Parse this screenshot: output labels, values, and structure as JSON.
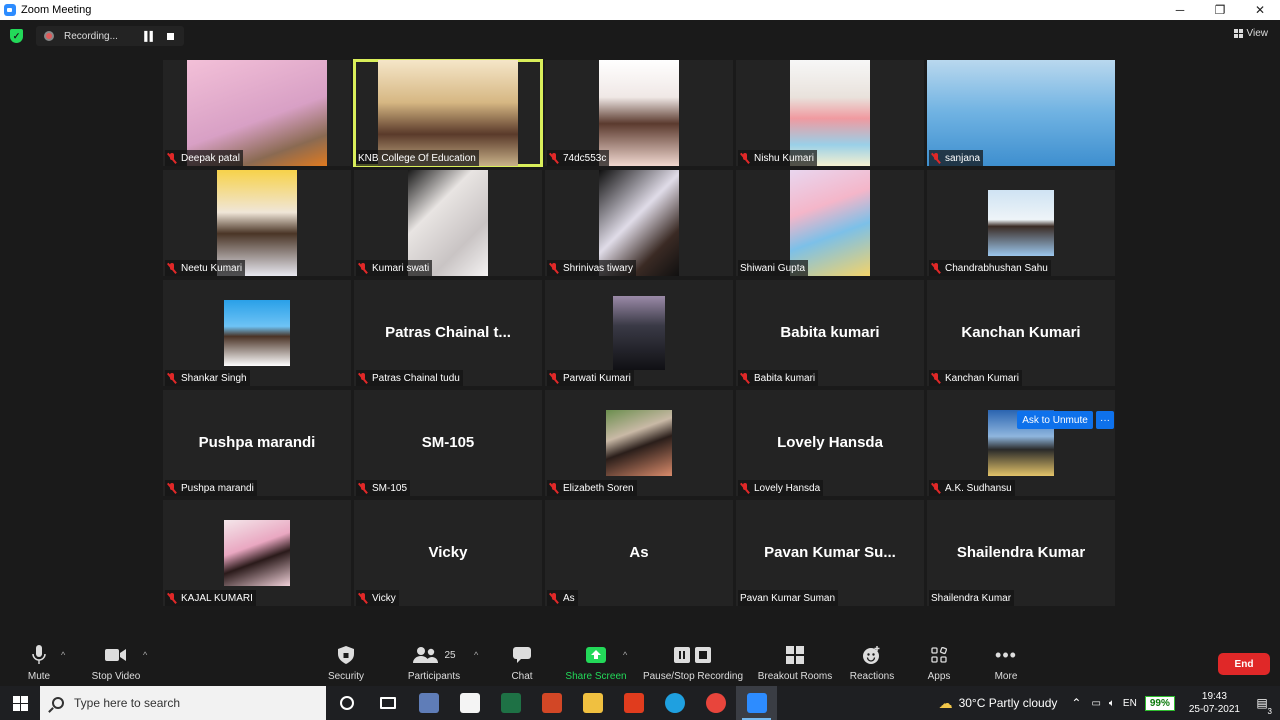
{
  "window": {
    "title": "Zoom Meeting",
    "minimize": "─",
    "restore": "❐",
    "close": "✕"
  },
  "topbar": {
    "recording_label": "Recording...",
    "view_label": "View"
  },
  "tiles": [
    {
      "name": "Deepak patal",
      "muted": true,
      "active": false,
      "video": true,
      "video_width": 140,
      "video_color": "linear-gradient(160deg,#f3c0d8 0%,#d8a0c5 55%,#8a6a52 80%,#e07a20 100%)"
    },
    {
      "name": "KNB College Of Education",
      "muted": false,
      "active": true,
      "video": true,
      "video_width": 140,
      "video_color": "linear-gradient(180deg,#f5e6c8 0%,#d6b783 40%,#5a3a2a 70%,#c9b28a 100%)"
    },
    {
      "name": "74dc553c",
      "muted": true,
      "active": false,
      "video": true,
      "video_width": 80,
      "video_color": "linear-gradient(180deg,#ffffff 0%,#f0e8e6 35%,#5b3a2e 60%,#f1d8d0 100%)"
    },
    {
      "name": "Nishu Kumari",
      "muted": true,
      "active": false,
      "video": true,
      "video_width": 80,
      "video_color": "linear-gradient(180deg,#f7f7f7 0%,#e9e2dc 35%,#f09aa0 55%,#9ad0e8 80%,#f5f0d0 100%)"
    },
    {
      "name": "sanjana",
      "muted": true,
      "active": false,
      "video": true,
      "video_width": 188,
      "video_color": "linear-gradient(180deg,#b9d8ee 0%,#6fb2e2 50%,#3e8fcf 100%)"
    },
    {
      "name": "Neetu Kumari",
      "muted": true,
      "active": false,
      "video": true,
      "video_width": 80,
      "video_color": "linear-gradient(180deg,#f7d24a 0%,#f0e6d8 40%,#4a3526 60%,#e8e8f0 100%)"
    },
    {
      "name": "Kumari swati",
      "muted": true,
      "active": false,
      "video": true,
      "video_width": 80,
      "video_color": "linear-gradient(135deg,#1a1a1a 0%,#e8e4e2 35%,#c9c4c4 70%,#f4f2f2 100%)"
    },
    {
      "name": "Shrinivas tiwary",
      "muted": true,
      "active": false,
      "video": true,
      "video_width": 80,
      "video_color": "linear-gradient(135deg,#101010 0%,#e0dce8 45%,#3a2a24 75%,#101010 100%)"
    },
    {
      "name": "Shiwani Gupta",
      "muted": false,
      "active": false,
      "video": true,
      "video_width": 80,
      "video_color": "linear-gradient(160deg,#e9d6ef 0%,#f4b6c9 35%,#7cc0e8 60%,#f3d36a 100%)"
    },
    {
      "name": "Chandrabhushan Sahu",
      "muted": true,
      "active": false,
      "video": true,
      "video_width": 66,
      "video_color": "linear-gradient(180deg,#cfe3f3 0%,#eef4f8 45%,#3b2c25 55%,#9cc7ee 100%)",
      "video_inset": 20
    },
    {
      "name": "Shankar Singh",
      "muted": true,
      "active": false,
      "video": true,
      "video_width": 66,
      "video_color": "linear-gradient(180deg,#2aa0e8 0%,#6ec3f5 40%,#4a3326 55%,#ffffff 100%)",
      "video_inset": 20
    },
    {
      "name": "Patras Chainal tudu",
      "big_name": "Patras Chainal t...",
      "muted": true,
      "active": false,
      "video": false
    },
    {
      "name": "Parwati Kumari",
      "muted": true,
      "active": false,
      "video": true,
      "video_width": 52,
      "video_color": "linear-gradient(180deg,#9b8aa8 0%,#3a3a46 40%,#101014 100%)",
      "video_inset": 16
    },
    {
      "name": "Babita kumari",
      "big_name": "Babita kumari",
      "muted": true,
      "active": false,
      "video": false
    },
    {
      "name": "Kanchan Kumari",
      "big_name": "Kanchan Kumari",
      "muted": true,
      "active": false,
      "video": false
    },
    {
      "name": "Pushpa marandi",
      "big_name": "Pushpa marandi",
      "muted": true,
      "active": false,
      "video": false
    },
    {
      "name": "SM-105",
      "big_name": "SM-105",
      "muted": true,
      "active": false,
      "video": false
    },
    {
      "name": "Elizabeth Soren",
      "muted": true,
      "active": false,
      "video": true,
      "video_width": 66,
      "video_color": "linear-gradient(160deg,#6b8e4e 0%,#c9b9a6 35%,#2a1e1a 55%,#d98b6b 100%)",
      "video_inset": 20
    },
    {
      "name": "Lovely Hansda",
      "big_name": "Lovely Hansda",
      "muted": true,
      "active": false,
      "video": false
    },
    {
      "name": "A.K. Sudhansu",
      "muted": true,
      "active": false,
      "video": true,
      "video_width": 66,
      "video_color": "linear-gradient(180deg,#2a64b0 0%,#8fb6de 40%,#2a2a2a 60%,#e4c46a 100%)",
      "video_inset": 20
    },
    {
      "name": "KAJAL KUMARI",
      "muted": true,
      "active": false,
      "video": true,
      "video_width": 66,
      "video_color": "linear-gradient(160deg,#f4e6ea 0%,#e9a7c1 40%,#2a1a1a 60%,#f0d0d8 100%)",
      "video_inset": 20
    },
    {
      "name": "Vicky",
      "big_name": "Vicky",
      "muted": true,
      "active": false,
      "video": false
    },
    {
      "name": "As",
      "big_name": "As",
      "muted": true,
      "active": false,
      "video": false
    },
    {
      "name": "Pavan Kumar Suman",
      "big_name": "Pavan Kumar Su...",
      "muted": false,
      "active": false,
      "video": false
    },
    {
      "name": "Shailendra Kumar",
      "big_name": "Shailendra Kumar",
      "muted": false,
      "active": false,
      "video": false
    }
  ],
  "participant_actions": {
    "ask_to_unmute": "Ask to Unmute",
    "more": "···"
  },
  "toolbar": {
    "mute": "Mute",
    "stop_video": "Stop Video",
    "security": "Security",
    "participants": "Participants",
    "participants_count": "25",
    "chat": "Chat",
    "share_screen": "Share Screen",
    "recording": "Pause/Stop Recording",
    "breakout": "Breakout Rooms",
    "reactions": "Reactions",
    "apps": "Apps",
    "more": "More",
    "end": "End"
  },
  "taskbar": {
    "search_placeholder": "Type here to search",
    "language": "EN",
    "battery": "99%",
    "weather": "30°C  Partly cloudy",
    "time": "19:43",
    "date": "25-07-2021",
    "notifications": "3",
    "apps": [
      {
        "name": "cortana",
        "color": "transparent"
      },
      {
        "name": "task-view",
        "color": "transparent"
      },
      {
        "name": "vscode",
        "color": "#5f7db8"
      },
      {
        "name": "store",
        "color": "#f4f4f4"
      },
      {
        "name": "excel",
        "color": "#1e7145"
      },
      {
        "name": "powerpoint",
        "color": "#d24726"
      },
      {
        "name": "file-explorer",
        "color": "#f0c040"
      },
      {
        "name": "office",
        "color": "#e03c1e"
      },
      {
        "name": "edge",
        "color": "#1fa0e0"
      },
      {
        "name": "chrome",
        "color": "#e8453c"
      },
      {
        "name": "zoom",
        "color": "#2d8cff"
      }
    ]
  },
  "colors": {
    "accent": "#0e71eb",
    "end": "#e02828",
    "share": "#23d959",
    "active_speaker": "#d9ee5a"
  }
}
